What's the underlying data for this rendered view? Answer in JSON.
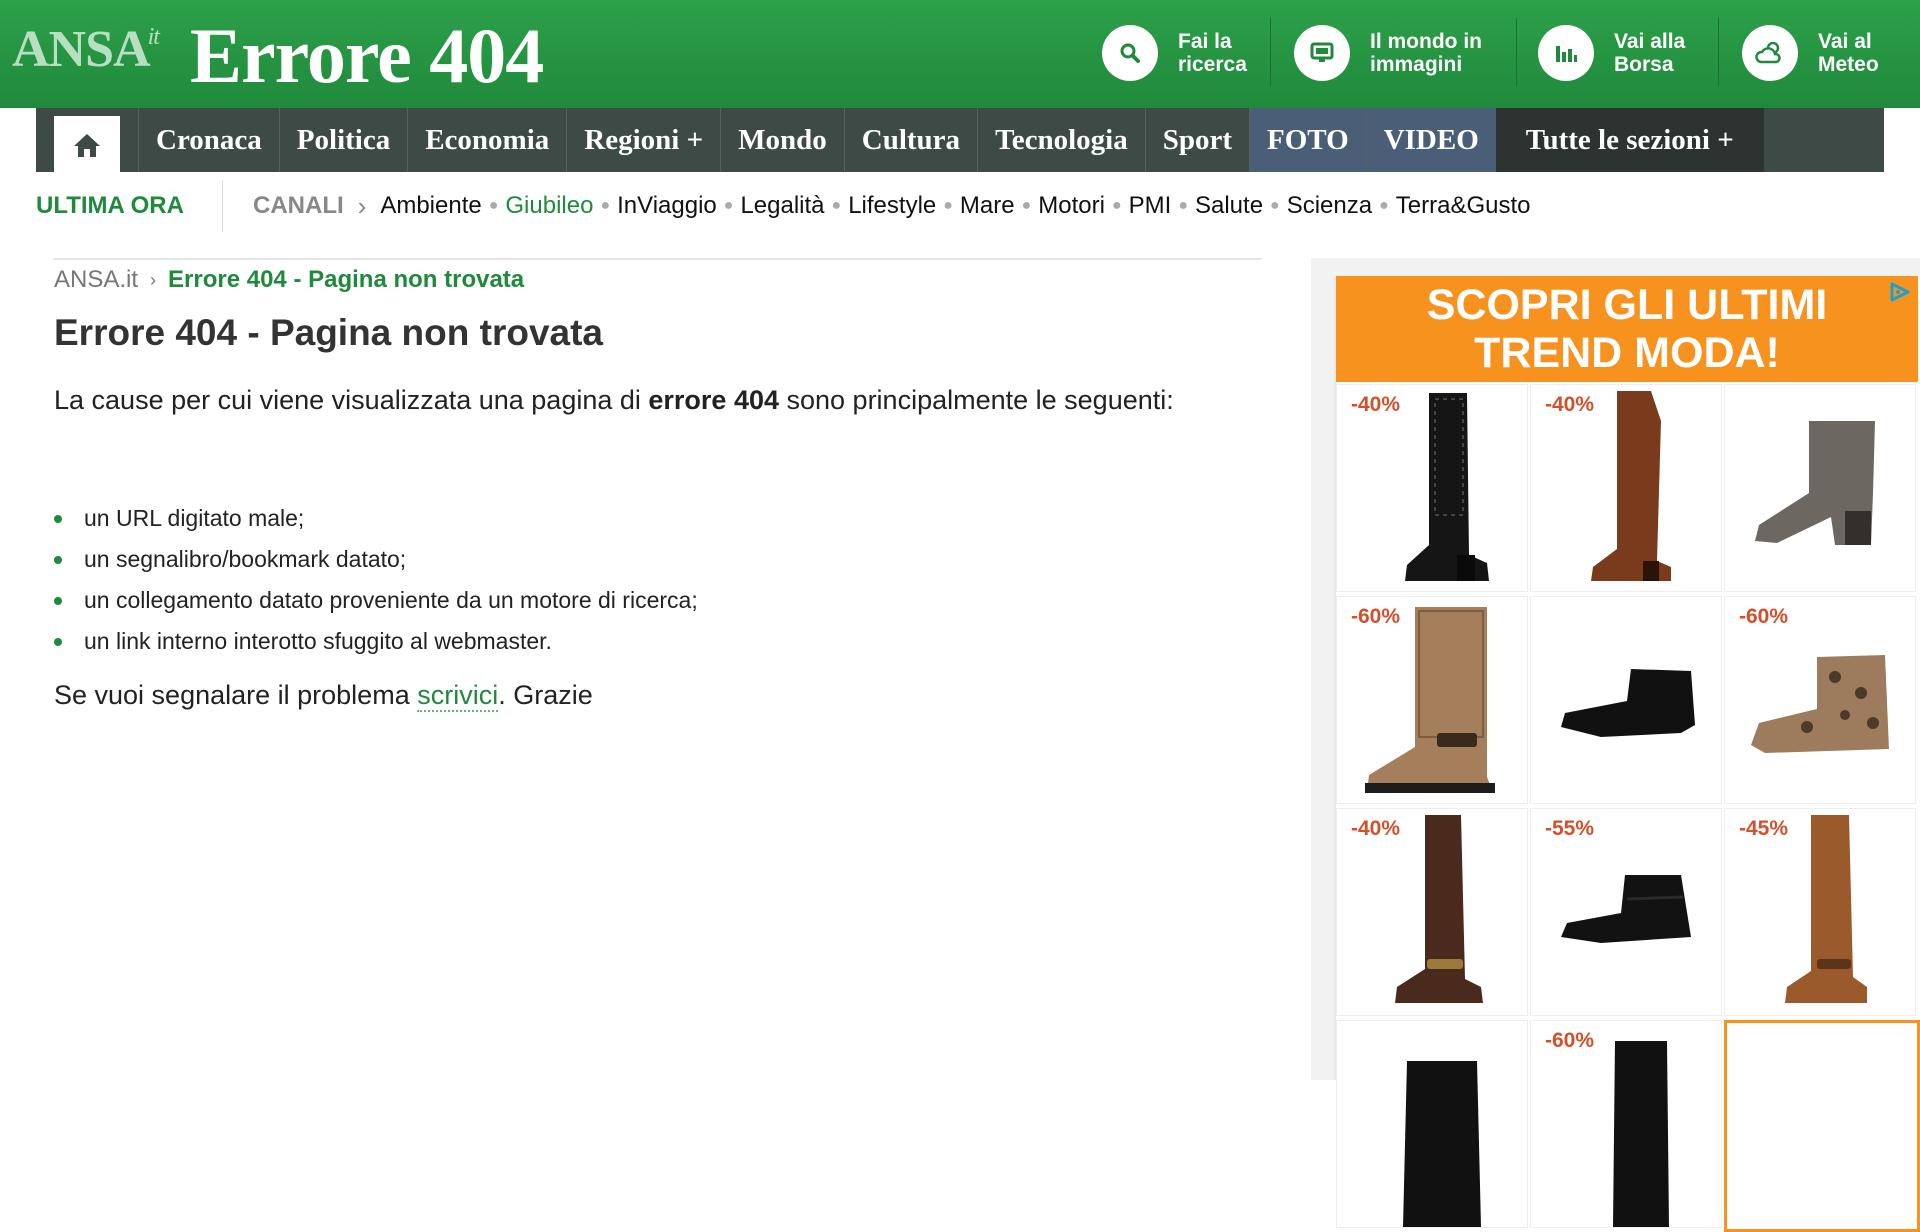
{
  "header": {
    "logo": "ANSA",
    "logo_suffix": "it",
    "title": "Errore 404",
    "quick_links": [
      {
        "label": "Fai la ricerca",
        "icon": "search-icon"
      },
      {
        "label": "Il mondo in immagini",
        "icon": "monitor-icon"
      },
      {
        "label": "Vai alla Borsa",
        "icon": "bar-chart-icon"
      },
      {
        "label": "Vai al Meteo",
        "icon": "weather-icon"
      }
    ]
  },
  "nav": {
    "home_icon": "home-icon",
    "items": [
      "Cronaca",
      "Politica",
      "Economia",
      "Regioni +",
      "Mondo",
      "Cultura",
      "Tecnologia",
      "Sport",
      "FOTO",
      "VIDEO"
    ],
    "all_sections": "Tutte le sezioni +"
  },
  "subnav": {
    "ultima_ora": "ULTIMA ORA",
    "canali": "CANALI",
    "channels": [
      "Ambiente",
      "Giubileo",
      "InViaggio",
      "Legalità",
      "Lifestyle",
      "Mare",
      "Motori",
      "PMI",
      "Salute",
      "Scienza",
      "Terra&Gusto"
    ],
    "highlight_color": "#1f8a3b"
  },
  "breadcrumb": {
    "home": "ANSA.it",
    "current": "Errore 404 - Pagina non trovata"
  },
  "content": {
    "title": "Errore 404 - Pagina non trovata",
    "intro_before": "La cause per cui viene visualizzata una pagina di ",
    "intro_bold": "errore 404",
    "intro_after": " sono principalmente le seguenti:",
    "causes": [
      "un URL digitato male;",
      "un segnalibro/bookmark datato;",
      "un collegamento datato proveniente da un motore di ricerca;",
      "un link interno interotto sfuggito al webmaster."
    ],
    "report_before": "Se vuoi segnalare il problema ",
    "report_link": "scrivici",
    "report_after": ". Grazie"
  },
  "ad": {
    "headline_1": "SCOPRI GLI ULTIMI",
    "headline_2": "TREND MODA!",
    "accent": "#f7921e",
    "products": [
      {
        "discount": "-40%",
        "item": "black-tall-boot"
      },
      {
        "discount": "-40%",
        "item": "brown-tall-boot"
      },
      {
        "discount": "",
        "item": "grey-ankle-boot"
      },
      {
        "discount": "-60%",
        "item": "quilted-tan-boot"
      },
      {
        "discount": "",
        "item": "black-chelsea-boot"
      },
      {
        "discount": "-60%",
        "item": "leopard-bootie"
      },
      {
        "discount": "-40%",
        "item": "dark-brown-tall-boot"
      },
      {
        "discount": "-55%",
        "item": "black-fringe-bootie"
      },
      {
        "discount": "-45%",
        "item": "cognac-tall-boot"
      },
      {
        "discount": "",
        "item": "black-boot"
      },
      {
        "discount": "-60%",
        "item": "black-boot"
      },
      {
        "discount": "",
        "item": "price-card"
      }
    ]
  }
}
